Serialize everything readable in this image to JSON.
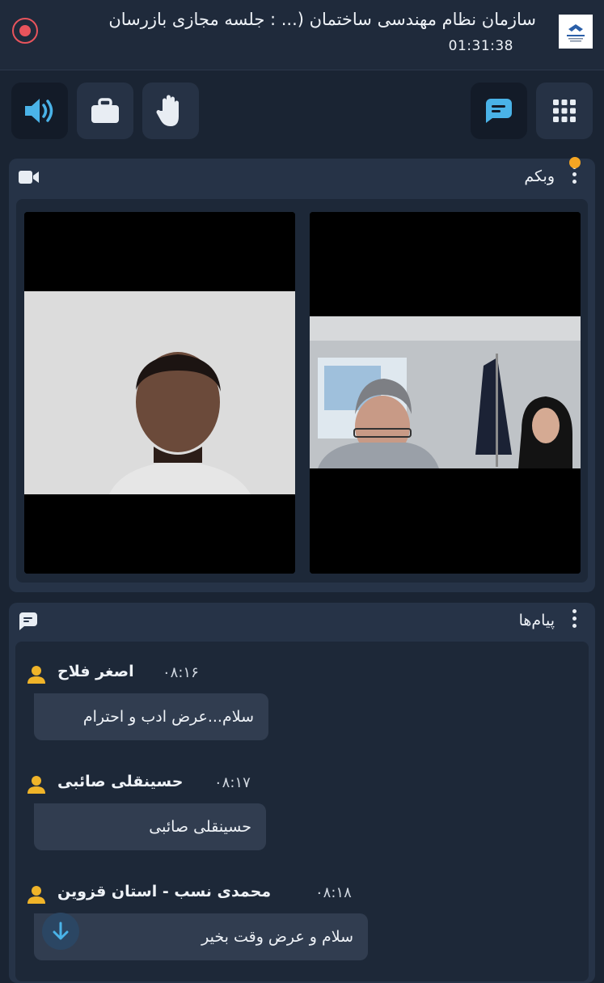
{
  "header": {
    "title": "سازمان نظام مهندسی ساختمان (...  : جلسه مجازی بازرسان",
    "timer": "01:31:38",
    "logo_icon": "organization-logo",
    "record_icon": "record-icon"
  },
  "toolbar": {
    "left": [
      {
        "name": "speaker-button",
        "icon": "speaker-icon",
        "active": true
      },
      {
        "name": "briefcase-button",
        "icon": "briefcase-icon",
        "active": false
      },
      {
        "name": "raise-hand-button",
        "icon": "hand-icon",
        "active": false
      }
    ],
    "right": [
      {
        "name": "chat-button",
        "icon": "chat-icon",
        "active": true
      },
      {
        "name": "apps-button",
        "icon": "grid-icon",
        "active": false
      }
    ]
  },
  "webcam": {
    "title": "وبکم",
    "icon": "video-camera-icon"
  },
  "messages_panel": {
    "title": "پیام‌ها",
    "icon": "chat-icon",
    "messages": [
      {
        "sender": "اصغر فلاح",
        "time": "۰۸:۱۶",
        "text": "سلام...عرض ادب و احترام"
      },
      {
        "sender": "حسینقلی صائبی",
        "time": "۰۸:۱۷",
        "text": "حسینقلی صائبی"
      },
      {
        "sender": "محمدی نسب - استان قزوین",
        "time": "۰۸:۱۸",
        "text": "سلام و عرض وقت بخیر"
      }
    ]
  },
  "colors": {
    "background": "#1a2433",
    "panel": "#263347",
    "accent": "#4ab3e8",
    "record": "#e8545c",
    "notification": "#f5a623",
    "avatar": "#f0b429"
  }
}
